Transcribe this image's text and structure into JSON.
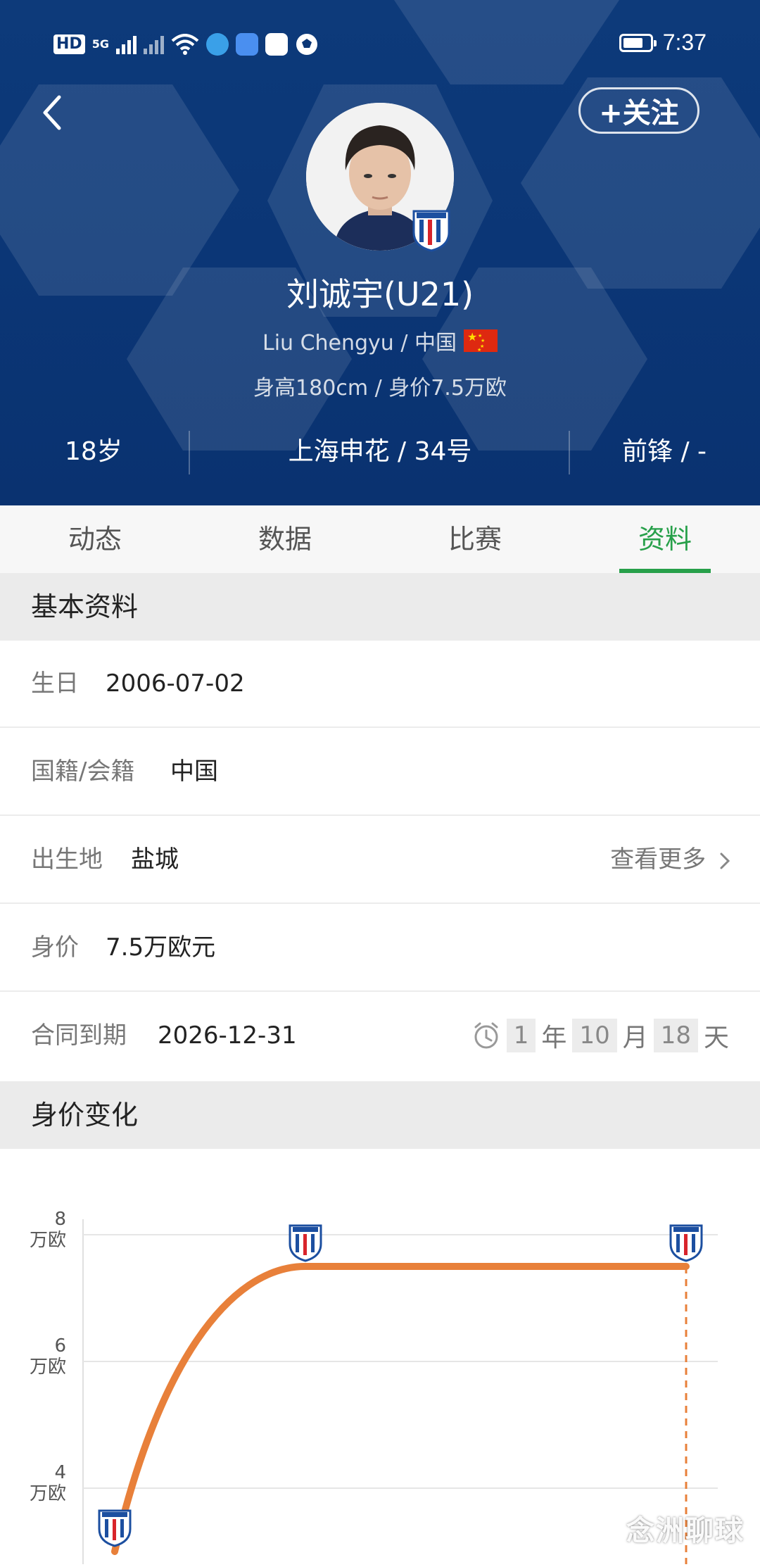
{
  "status_bar": {
    "hd": "HD",
    "net_5g": "5G",
    "time": "7:37",
    "battery_level": 0.75
  },
  "header": {
    "back_icon": "chevron-left-icon",
    "follow_label": "+关注",
    "name": "刘诚宇(U21)",
    "subtitle": "Liu Chengyu / 中国",
    "meta": "身高180cm / 身价7.5万欧",
    "stats": {
      "age": "18岁",
      "club_number": "上海申花 / 34号",
      "position": "前锋 / -"
    }
  },
  "tabs": [
    {
      "label": "动态",
      "active": false
    },
    {
      "label": "数据",
      "active": false
    },
    {
      "label": "比赛",
      "active": false
    },
    {
      "label": "资料",
      "active": true
    }
  ],
  "basic_info": {
    "title": "基本资料",
    "rows": [
      {
        "label": "生日",
        "value": "2006-07-02"
      },
      {
        "label": "国籍/会籍",
        "value": "中国"
      },
      {
        "label": "出生地",
        "value": "盐城",
        "more": "查看更多"
      },
      {
        "label": "身价",
        "value": "7.5万欧元"
      },
      {
        "label": "合同到期",
        "value": "2026-12-31"
      }
    ],
    "countdown": {
      "years": "1",
      "years_unit": "年",
      "months": "10",
      "months_unit": "月",
      "days": "18",
      "days_unit": "天"
    }
  },
  "market_value": {
    "title": "身价变化"
  },
  "chart_data": {
    "type": "line",
    "y_ticks": [
      {
        "value": 8,
        "label": "8",
        "unit": "万欧"
      },
      {
        "value": 6,
        "label": "6",
        "unit": "万欧"
      },
      {
        "value": 4,
        "label": "4",
        "unit": "万欧"
      }
    ],
    "series": [
      {
        "values": [
          3,
          7.5,
          7.5
        ]
      }
    ],
    "color": "#e8803a"
  },
  "watermark": "念洲聊球",
  "colors": {
    "header_bg": "#0b3676",
    "accent_green": "#27a04a",
    "line_orange": "#e8803a"
  }
}
